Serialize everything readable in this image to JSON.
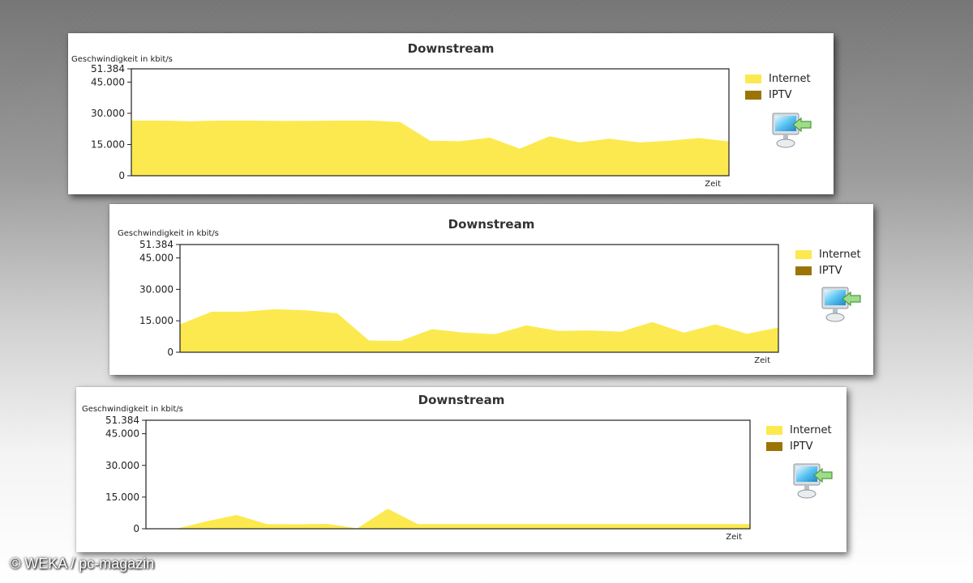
{
  "watermark": "© WEKA / pc-magazin",
  "legend": {
    "internet_label": "Internet",
    "iptv_label": "IPTV",
    "internet_color": "#fce94f",
    "iptv_color": "#9c7406"
  },
  "icons": {
    "device": "monitor-download-icon"
  },
  "chart_data": [
    {
      "type": "area",
      "title": "Downstream",
      "ylabel": "Geschwindigkeit in kbit/s",
      "xlabel": "Zeit",
      "ylim": [
        0,
        51384
      ],
      "yticks": [
        0,
        15000,
        30000,
        45000,
        51384
      ],
      "ytick_labels": [
        "0",
        "15.000",
        "30.000",
        "45.000",
        "51.384"
      ],
      "legend_position": "right",
      "series": [
        {
          "name": "Internet",
          "color": "#fce94f",
          "values": [
            26500,
            26500,
            26200,
            26500,
            26500,
            26300,
            26400,
            26500,
            26500,
            25800,
            16800,
            16600,
            18300,
            13000,
            19000,
            16000,
            17800,
            16000,
            16800,
            18100,
            16500
          ]
        },
        {
          "name": "IPTV",
          "color": "#9c7406",
          "values": []
        }
      ]
    },
    {
      "type": "area",
      "title": "Downstream",
      "ylabel": "Geschwindigkeit in kbit/s",
      "xlabel": "Zeit",
      "ylim": [
        0,
        51384
      ],
      "yticks": [
        0,
        15000,
        30000,
        45000,
        51384
      ],
      "ytick_labels": [
        "0",
        "15.000",
        "30.000",
        "45.000",
        "51.384"
      ],
      "legend_position": "right",
      "series": [
        {
          "name": "Internet",
          "color": "#fce94f",
          "values": [
            13300,
            19300,
            19300,
            20500,
            20000,
            18500,
            5600,
            5400,
            11000,
            9400,
            8600,
            12800,
            10200,
            10400,
            9800,
            14400,
            9300,
            13300,
            8800,
            11800
          ]
        },
        {
          "name": "IPTV",
          "color": "#9c7406",
          "values": []
        }
      ]
    },
    {
      "type": "area",
      "title": "Downstream",
      "ylabel": "Geschwindigkeit in kbit/s",
      "xlabel": "Zeit",
      "ylim": [
        0,
        51384
      ],
      "yticks": [
        0,
        15000,
        30000,
        45000,
        51384
      ],
      "ytick_labels": [
        "0",
        "15.000",
        "30.000",
        "45.000",
        "51.384"
      ],
      "legend_position": "right",
      "series": [
        {
          "name": "Internet",
          "color": "#fce94f",
          "values": [
            0,
            0,
            3500,
            6500,
            2200,
            2100,
            2300,
            200,
            9500,
            2200,
            2200,
            2200,
            2200,
            2200,
            2200,
            2200,
            2200,
            2200,
            2200,
            2200,
            2200
          ]
        },
        {
          "name": "IPTV",
          "color": "#9c7406",
          "values": []
        }
      ]
    }
  ]
}
